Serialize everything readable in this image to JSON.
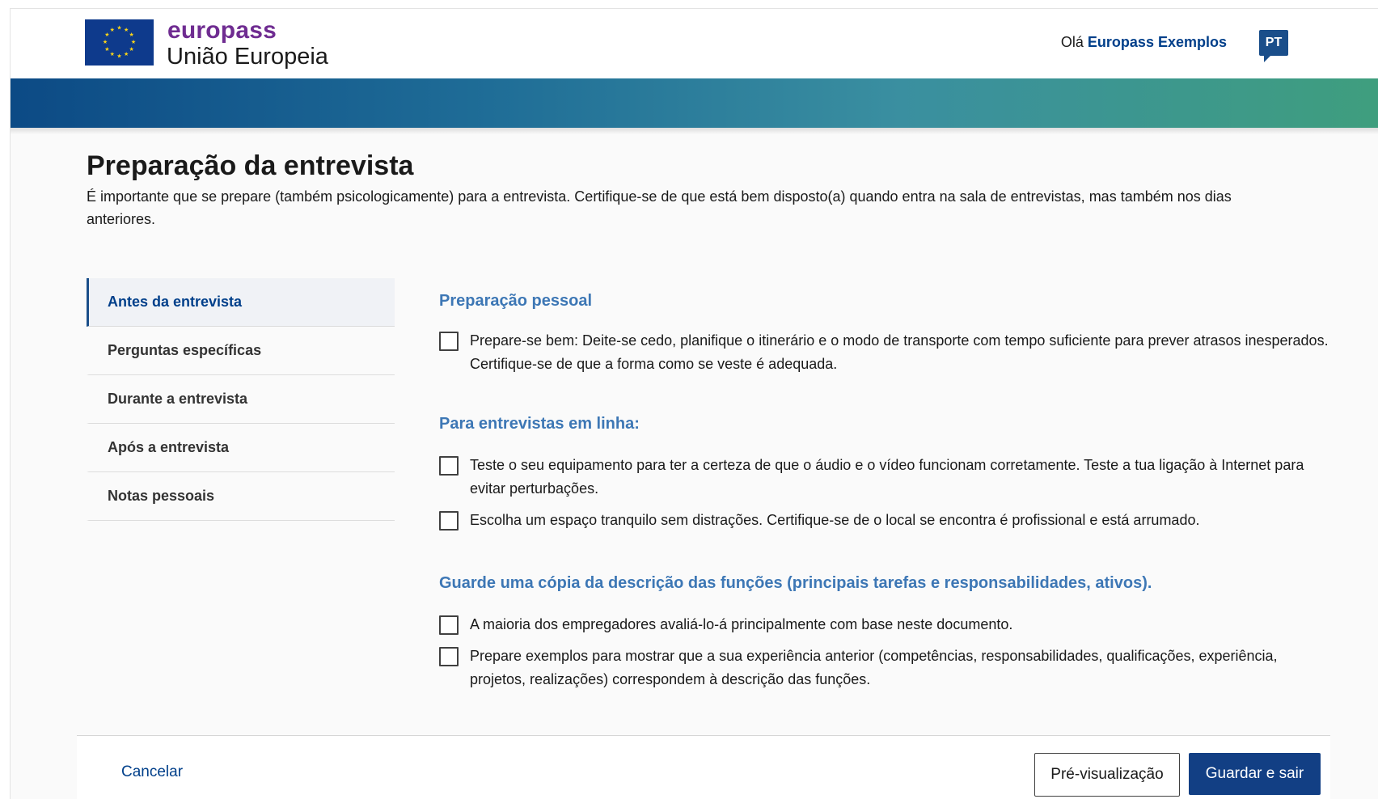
{
  "header": {
    "brand_name": "europass",
    "brand_sub": "União Europeia",
    "greeting_prefix": "Olá",
    "user_name": "Europass Exemplos",
    "language": "PT"
  },
  "page": {
    "title": "Preparação da entrevista",
    "intro": "É importante que se prepare (também psicologicamente) para a entrevista. Certifique-se de que está bem disposto(a) quando entra na sala de entrevistas, mas também nos dias anteriores."
  },
  "sidebar": {
    "items": [
      {
        "label": "Antes da entrevista",
        "active": true
      },
      {
        "label": "Perguntas específicas",
        "active": false
      },
      {
        "label": "Durante a entrevista",
        "active": false
      },
      {
        "label": "Após a entrevista",
        "active": false
      },
      {
        "label": "Notas pessoais",
        "active": false
      }
    ]
  },
  "sections": [
    {
      "title": "Preparação pessoal",
      "items": [
        "Prepare-se bem: Deite-se cedo, planifique o itinerário e o modo de transporte com tempo suficiente para prever atrasos inesperados. Certifique-se de que a forma como se veste é adequada."
      ]
    },
    {
      "title": "Para entrevistas em linha:",
      "items": [
        "Teste o seu equipamento para ter a certeza de que o áudio e o vídeo funcionam corretamente. Teste a tua ligação à Internet para evitar perturbações.",
        "Escolha um espaço tranquilo sem distrações. Certifique-se de o local se encontra é profissional e está arrumado."
      ]
    },
    {
      "title": "Guarde uma cópia da descrição das funções (principais tarefas e responsabilidades, ativos).",
      "items": [
        "A maioria dos empregadores avaliá-lo-á principalmente com base neste documento.",
        "Prepare exemplos para mostrar que a sua experiência anterior (competências, responsabilidades, qualificações, experiência, projetos, realizações) correspondem à descrição das funções."
      ]
    }
  ],
  "footer": {
    "cancel_label": "Cancelar",
    "preview_label": "Pré-visualização",
    "save_label": "Guardar e sair"
  },
  "colors": {
    "brand_purple": "#6f2c91",
    "link_blue": "#003f8a",
    "section_blue": "#3d77b5",
    "primary_button": "#123f84",
    "eu_flag_blue": "#0e3a8c",
    "eu_star_yellow": "#ffd617"
  },
  "icons": {
    "logo": "eu-flag-icon",
    "language": "speech-bubble-icon",
    "checkbox": "checkbox-unchecked-icon"
  }
}
